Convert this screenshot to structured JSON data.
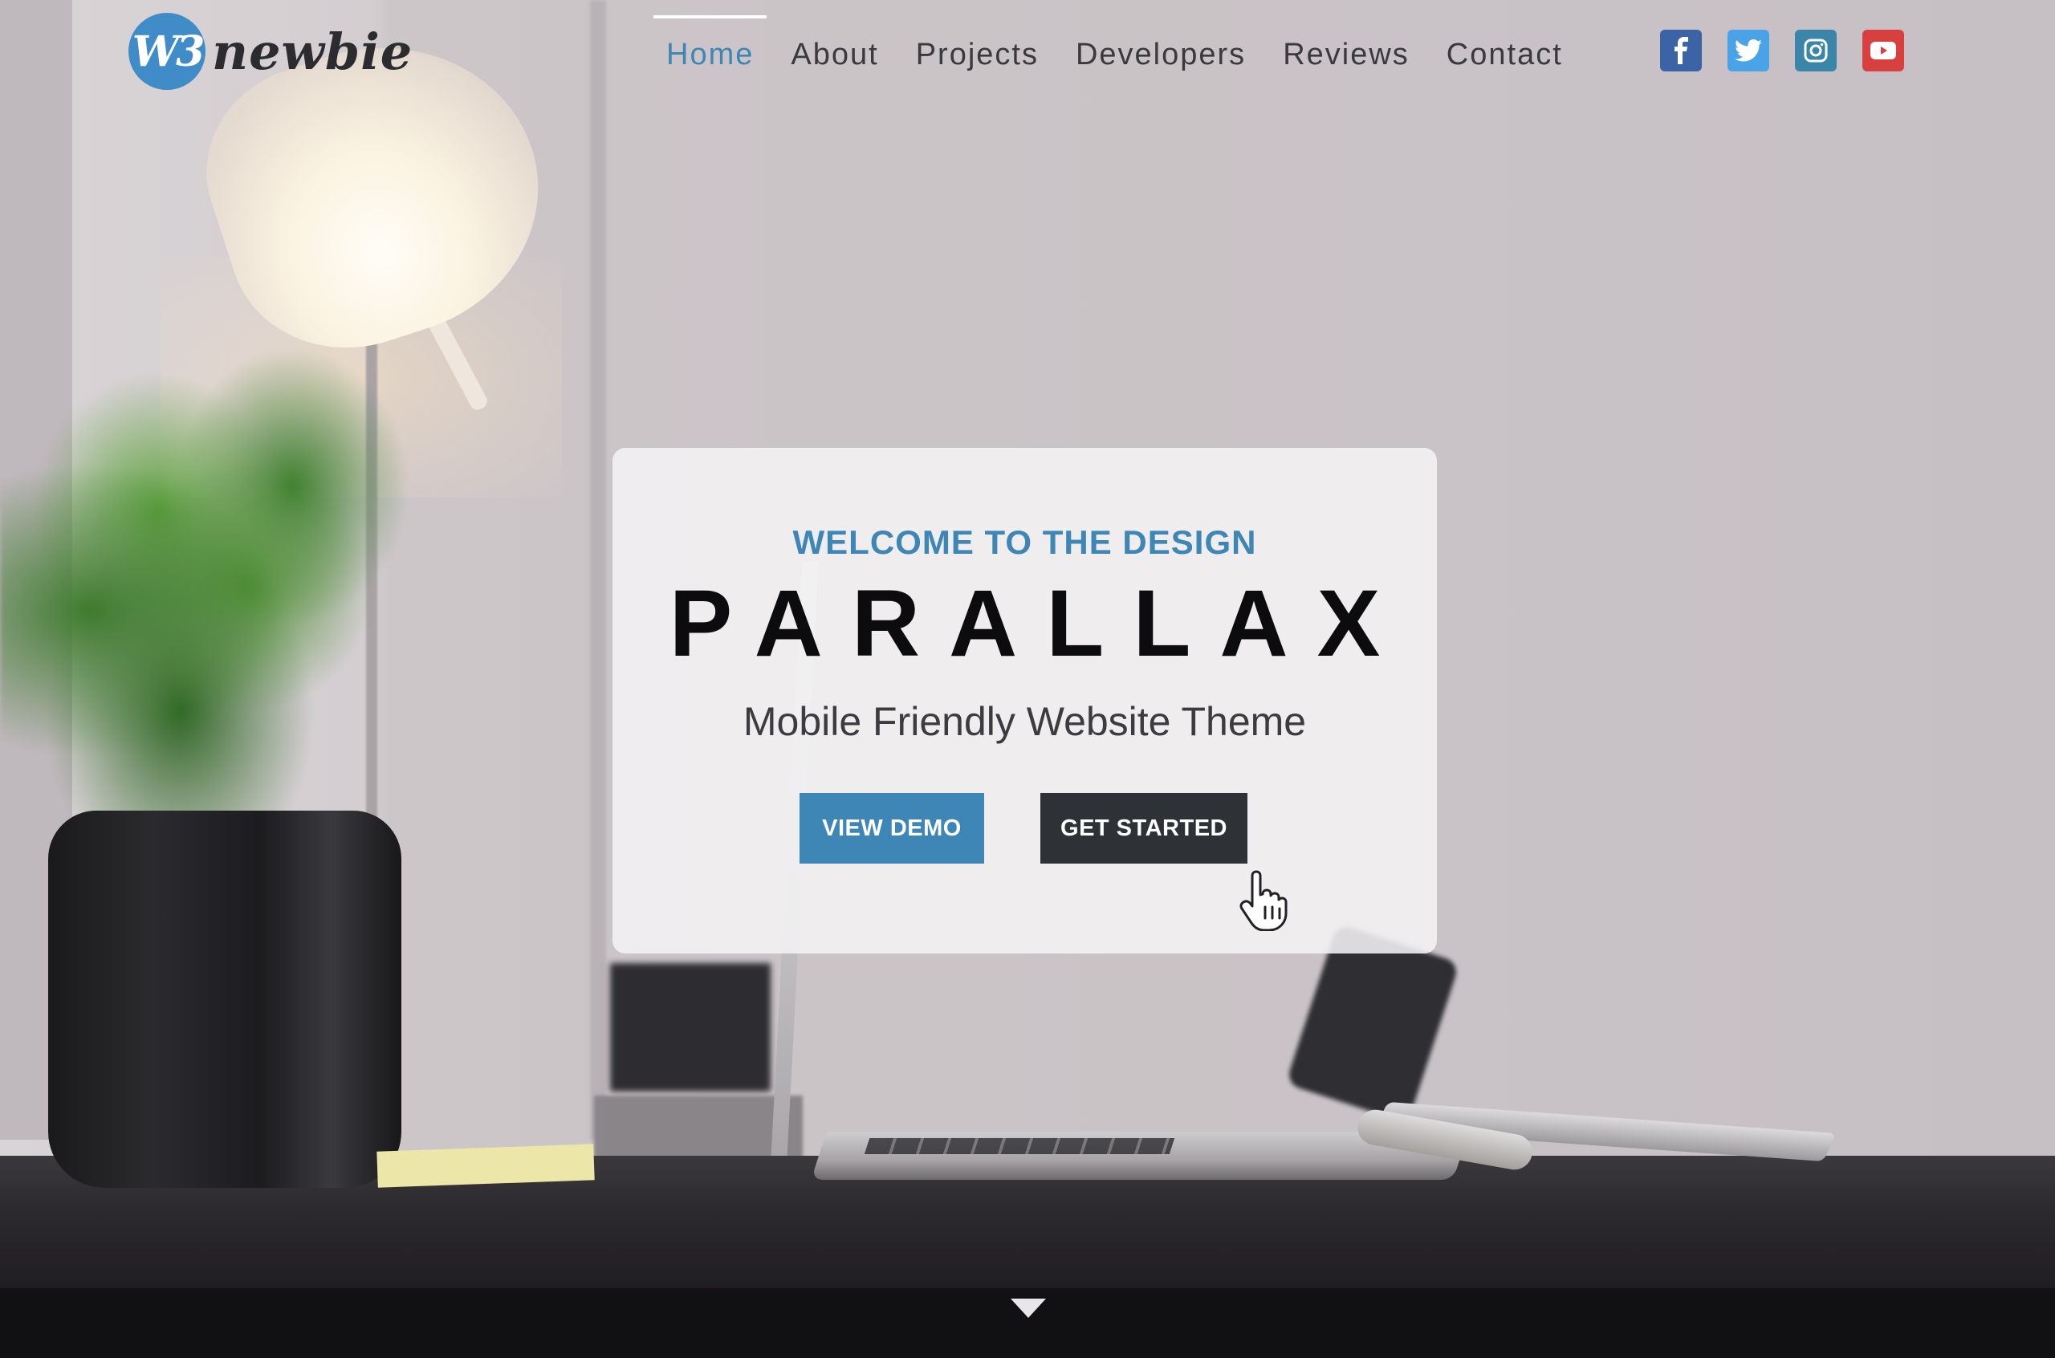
{
  "brand": {
    "badge": "W3",
    "name": "newbie"
  },
  "nav": {
    "items": [
      {
        "label": "Home",
        "active": true
      },
      {
        "label": "About"
      },
      {
        "label": "Projects"
      },
      {
        "label": "Developers"
      },
      {
        "label": "Reviews"
      },
      {
        "label": "Contact"
      }
    ]
  },
  "social": [
    {
      "icon": "facebook-icon",
      "color": "#3c63a6"
    },
    {
      "icon": "twitter-icon",
      "color": "#4aa3e6"
    },
    {
      "icon": "instagram-icon",
      "color": "#3b86a8"
    },
    {
      "icon": "youtube-icon",
      "color": "#d8403f"
    }
  ],
  "hero": {
    "eyebrow": "WELCOME TO THE DESIGN",
    "title": "PARALLAX",
    "subtitle": "Mobile Friendly Website Theme",
    "primary_button": "VIEW DEMO",
    "secondary_button": "GET STARTED"
  },
  "colors": {
    "accent": "#3d86b6",
    "dark_button": "#2e3136",
    "active_nav": "#3d86b6"
  },
  "icons": {
    "cursor": "hand-pointer-icon",
    "scroll": "chevron-down-icon"
  }
}
